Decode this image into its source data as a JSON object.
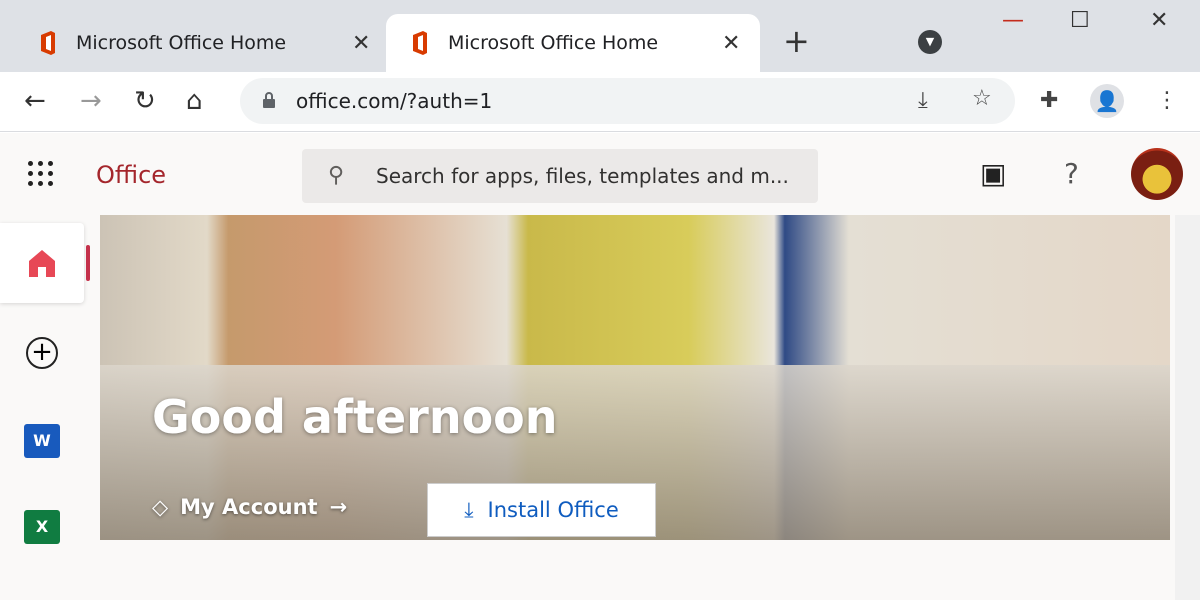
{
  "browser": {
    "tabs": [
      {
        "title": "Microsoft Office Home",
        "active": false
      },
      {
        "title": "Microsoft Office Home",
        "active": true
      }
    ],
    "url": "office.com/?auth=1"
  },
  "office": {
    "brand": "Office",
    "search_placeholder": "Search for apps, files, templates and m...",
    "help": "?",
    "greeting": "Good afternoon",
    "my_account": "My Account",
    "install_office": "Install Office",
    "accent": "#a4262c",
    "link_color": "#0f5cbf"
  }
}
